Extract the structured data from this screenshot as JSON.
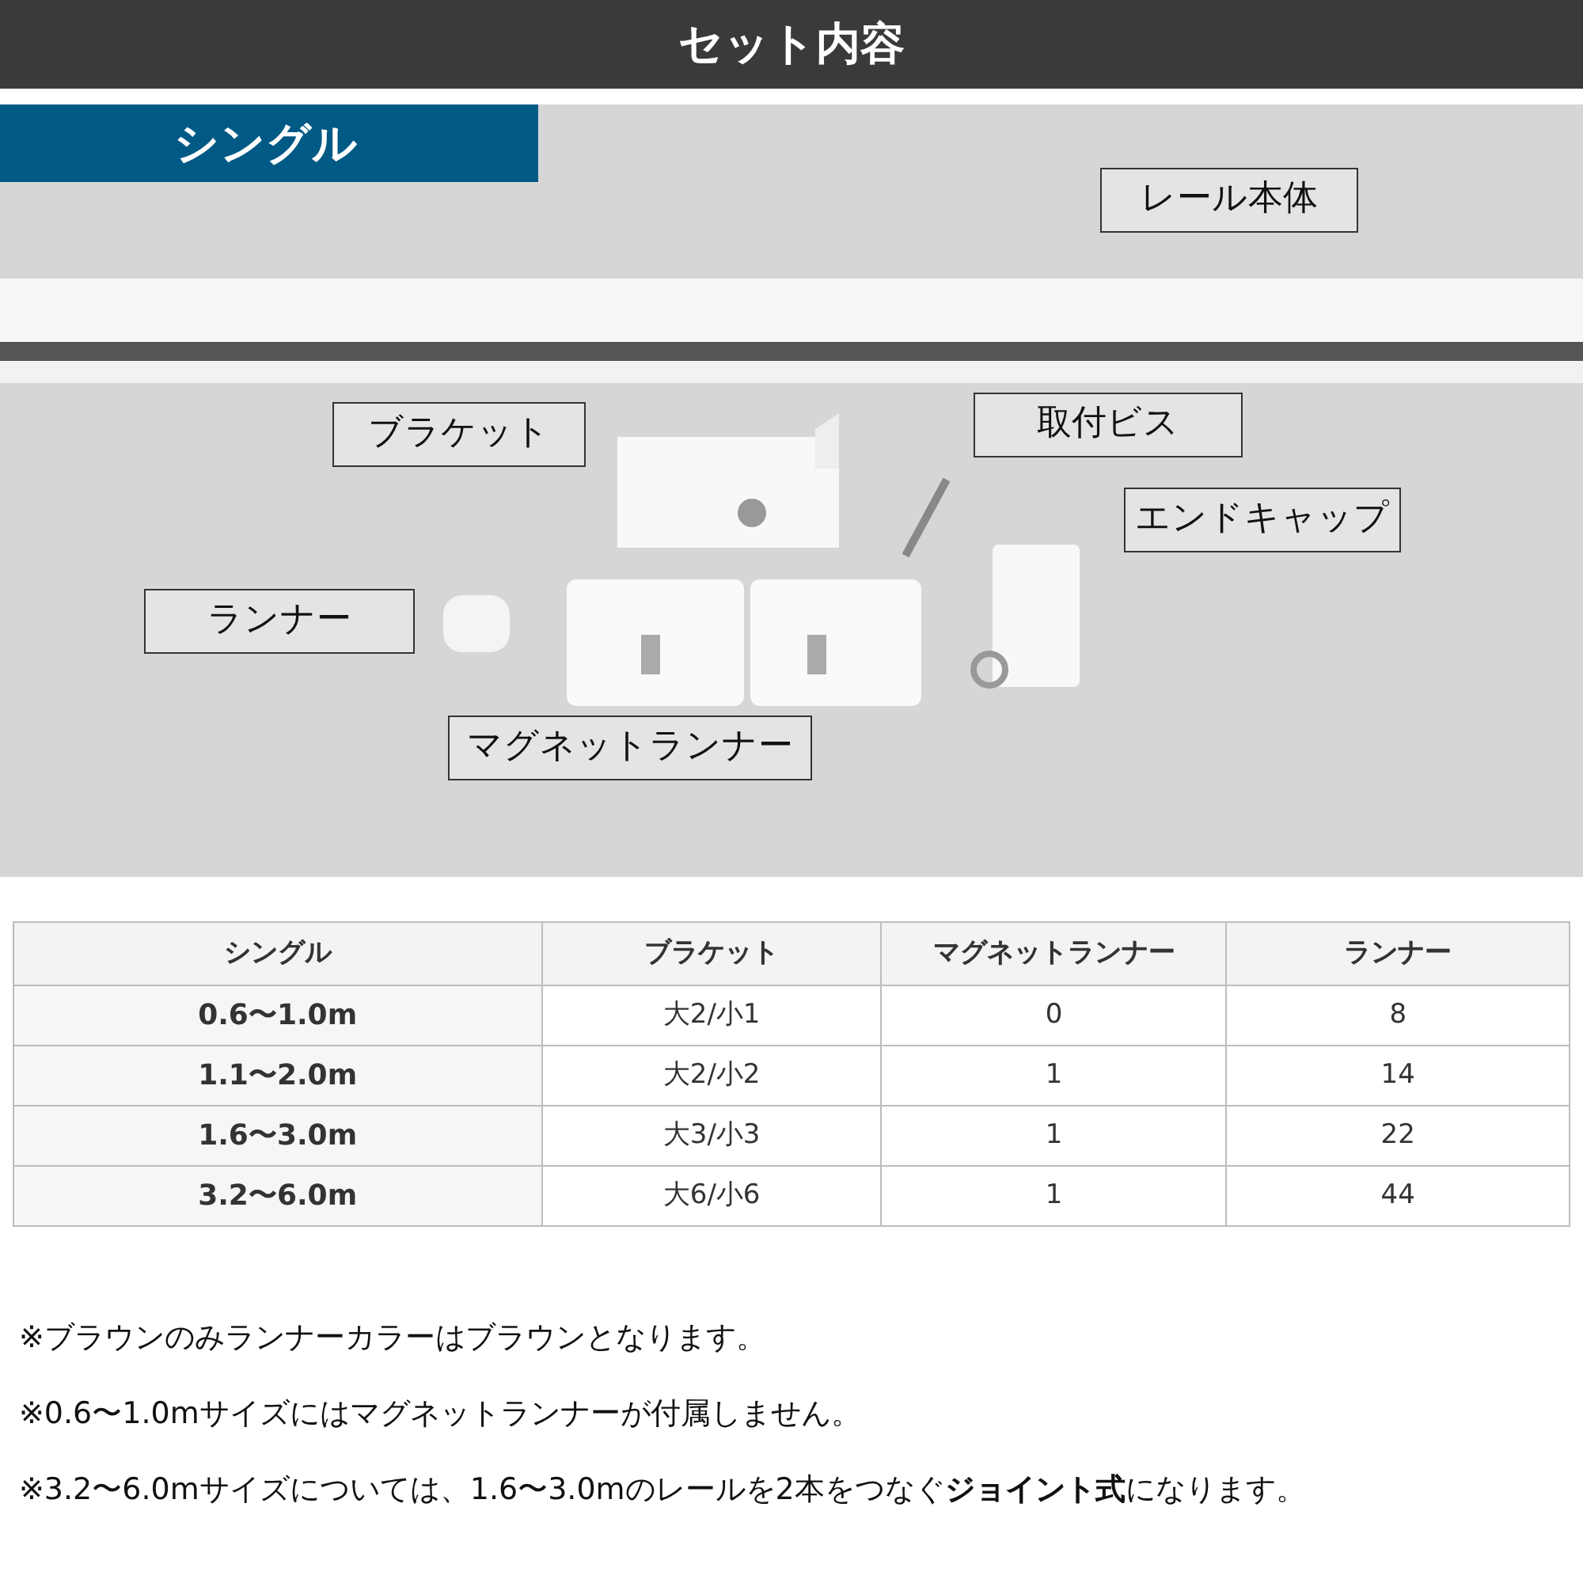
{
  "header": {
    "title": "セット内容"
  },
  "section": {
    "title": "シングル"
  },
  "photo": {
    "kind": "picture",
    "callouts": [
      {
        "label": "レール本体"
      },
      {
        "label": "ブラケット"
      },
      {
        "label": "取付ビス"
      },
      {
        "label": "エンドキャップ"
      },
      {
        "label": "ランナー"
      },
      {
        "label": "マグネットランナー"
      }
    ]
  },
  "table": {
    "columns": [
      "シングル",
      "ブラケット",
      "マグネットランナー",
      "ランナー"
    ],
    "rows": [
      [
        "0.6〜1.0m",
        "大2/小1",
        "0",
        "8"
      ],
      [
        "1.1〜2.0m",
        "大2/小2",
        "1",
        "14"
      ],
      [
        "1.6〜3.0m",
        "大3/小3",
        "1",
        "22"
      ],
      [
        "3.2〜6.0m",
        "大6/小6",
        "1",
        "44"
      ]
    ]
  },
  "notes": [
    "※ブラウンのみランナーカラーはブラウンとなります。",
    "※0.6〜1.0mサイズにはマグネットランナーが付属しません。",
    "※3.2〜6.0mサイズについては、1.6〜3.0mのレールを2本をつなぐ**ジョイント式**になります。"
  ]
}
